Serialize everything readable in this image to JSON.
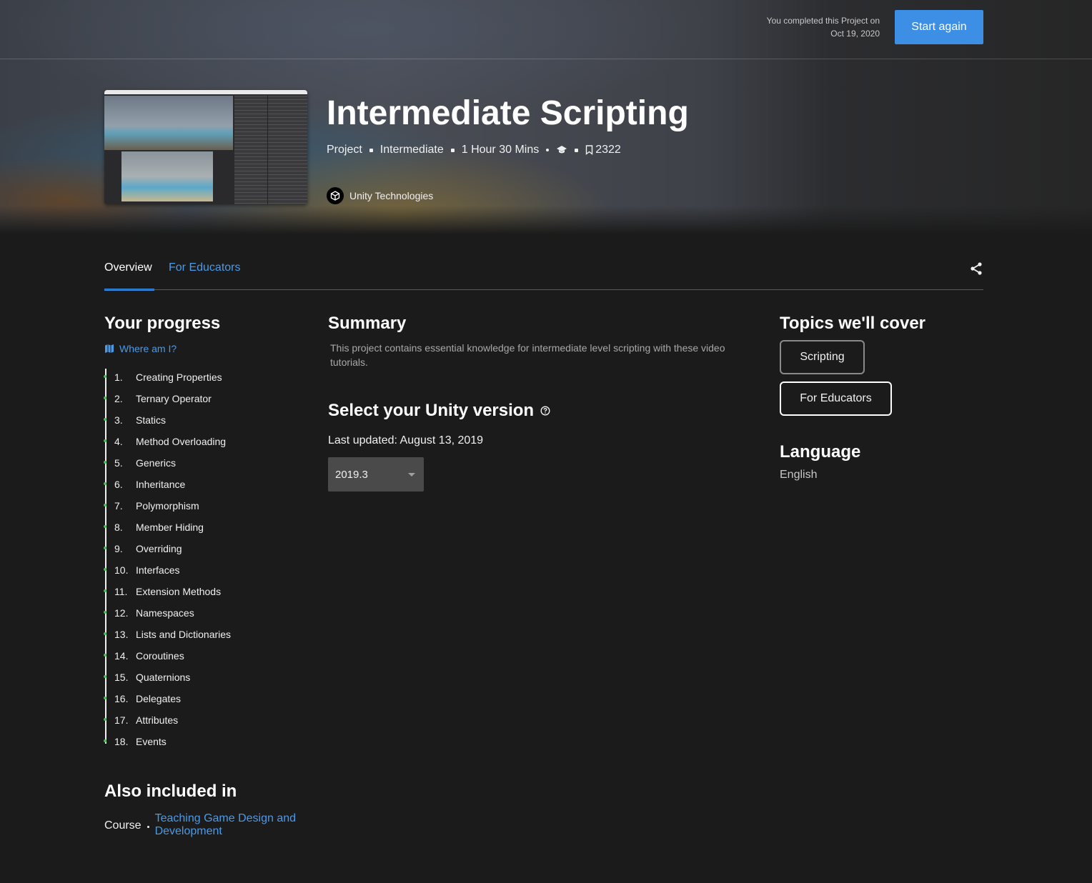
{
  "header": {
    "completed_line1": "You completed this Project on",
    "completed_line2": "Oct 19, 2020",
    "start_again_label": "Start again"
  },
  "project": {
    "title": "Intermediate Scripting",
    "meta_type": "Project",
    "meta_level": "Intermediate",
    "meta_duration": "1 Hour 30 Mins",
    "bookmark_count": "2322",
    "author": "Unity Technologies",
    "meta_icons": [
      "graduation-cap-icon",
      "bookmark-icon"
    ]
  },
  "tabs": {
    "overview": "Overview",
    "educators": "For Educators"
  },
  "progress": {
    "heading": "Your progress",
    "where_label": "Where am I?",
    "steps": [
      {
        "num": "1.",
        "label": "Creating Properties"
      },
      {
        "num": "2.",
        "label": "Ternary Operator"
      },
      {
        "num": "3.",
        "label": "Statics"
      },
      {
        "num": "4.",
        "label": "Method Overloading"
      },
      {
        "num": "5.",
        "label": "Generics"
      },
      {
        "num": "6.",
        "label": "Inheritance"
      },
      {
        "num": "7.",
        "label": "Polymorphism"
      },
      {
        "num": "8.",
        "label": "Member Hiding"
      },
      {
        "num": "9.",
        "label": "Overriding"
      },
      {
        "num": "10.",
        "label": "Interfaces"
      },
      {
        "num": "11.",
        "label": "Extension Methods"
      },
      {
        "num": "12.",
        "label": "Namespaces"
      },
      {
        "num": "13.",
        "label": "Lists and Dictionaries"
      },
      {
        "num": "14.",
        "label": "Coroutines"
      },
      {
        "num": "15.",
        "label": "Quaternions"
      },
      {
        "num": "16.",
        "label": "Delegates"
      },
      {
        "num": "17.",
        "label": "Attributes"
      },
      {
        "num": "18.",
        "label": "Events"
      }
    ]
  },
  "also_included": {
    "heading": "Also included in",
    "type": "Course",
    "link_line1": "Teaching Game Design and",
    "link_line2": "Development"
  },
  "summary": {
    "heading": "Summary",
    "text": "This project contains essential knowledge for intermediate level scripting with these video tutorials."
  },
  "version": {
    "heading": "Select your Unity version",
    "updated": "Last updated: August 13, 2019",
    "selected": "2019.3"
  },
  "topics": {
    "heading": "Topics we'll cover",
    "chips": [
      "Scripting",
      "For Educators"
    ]
  },
  "language": {
    "heading": "Language",
    "value": "English"
  },
  "colors": {
    "accent": "#3d8fe6",
    "link": "#4a9ae8",
    "progress_dot": "#3fbf4f",
    "background": "#1b1b1b"
  }
}
